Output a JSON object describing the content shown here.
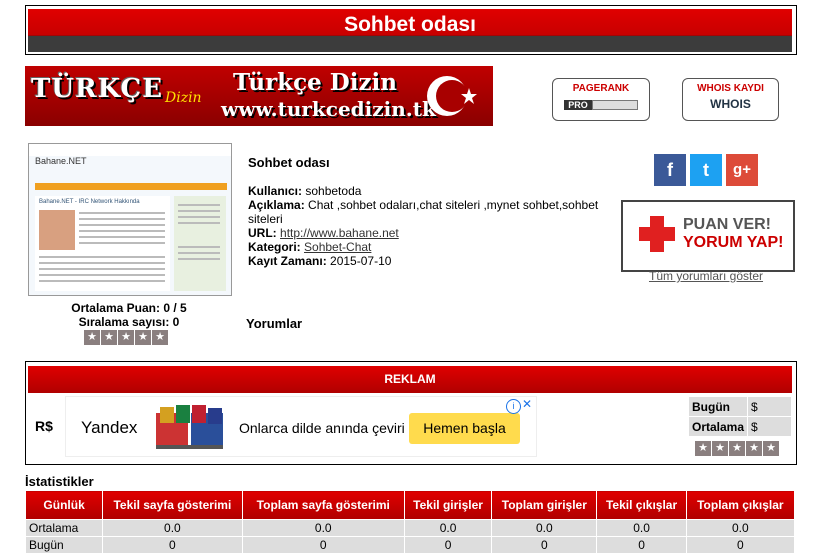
{
  "page": {
    "title": "Sohbet odası"
  },
  "banner": {
    "logo_main": "TÜRKÇE",
    "logo_sub": "Dizin",
    "title": "Türkçe Dizin",
    "url": "www.turkcedizin.tk"
  },
  "badges": {
    "pagerank_top": "PAGERANK",
    "pagerank_bottom": "PRO",
    "whois_top": "WHOIS KAYDI",
    "whois_bottom": "WHOIS"
  },
  "thumbnail": {
    "brand": "Bahane.NET",
    "subtitle": "Bahane.NET - IRC Network Hakkında"
  },
  "ratings": {
    "average": "Ortalama Puan: 0 / 5",
    "rank_count": "Sıralama sayısı: 0"
  },
  "info": {
    "title": "Sohbet odası",
    "user_label": "Kullanıcı:",
    "user_value": "sohbetoda",
    "desc_label": "Açıklama:",
    "desc_value": "Chat ,sohbet odaları,chat siteleri ,mynet sohbet,sohbet siteleri",
    "url_label": "URL:",
    "url_value": "http://www.bahane.net",
    "category_label": "Kategori:",
    "category_value": "Sohbet-Chat",
    "date_label": "Kayıt Zamanı:",
    "date_value": "2015-07-10"
  },
  "comments_heading": "Yorumlar",
  "social": {
    "facebook": "f",
    "twitter": "t",
    "googleplus": "g+"
  },
  "vote": {
    "line1": "PUAN VER!",
    "line2": "YORUM YAP!",
    "all_comments": "Tüm yorumları göster"
  },
  "reklam": {
    "heading": "REKLAM",
    "rs_label": "R$",
    "ad": {
      "brand": "Yandex",
      "text": "Onlarca dilde anında çeviri",
      "button": "Hemen başla"
    },
    "mini": [
      {
        "key": "Bugün",
        "value": "$"
      },
      {
        "key": "Ortalama",
        "value": "$"
      }
    ]
  },
  "stats": {
    "heading": "İstatistikler",
    "columns": [
      "Günlük",
      "Tekil sayfa gösterimi",
      "Toplam sayfa gösterimi",
      "Tekil girişler",
      "Toplam girişler",
      "Tekil çıkışlar",
      "Toplam çıkışlar"
    ],
    "rows": [
      [
        "Ortalama",
        "0.0",
        "0.0",
        "0.0",
        "0.0",
        "0.0",
        "0.0"
      ],
      [
        "Bugün",
        "0",
        "0",
        "0",
        "0",
        "0",
        "0"
      ]
    ]
  },
  "colors": {
    "accent": "#cc0000",
    "dark": "#3c3c3c",
    "star": "#8a7f7f"
  }
}
